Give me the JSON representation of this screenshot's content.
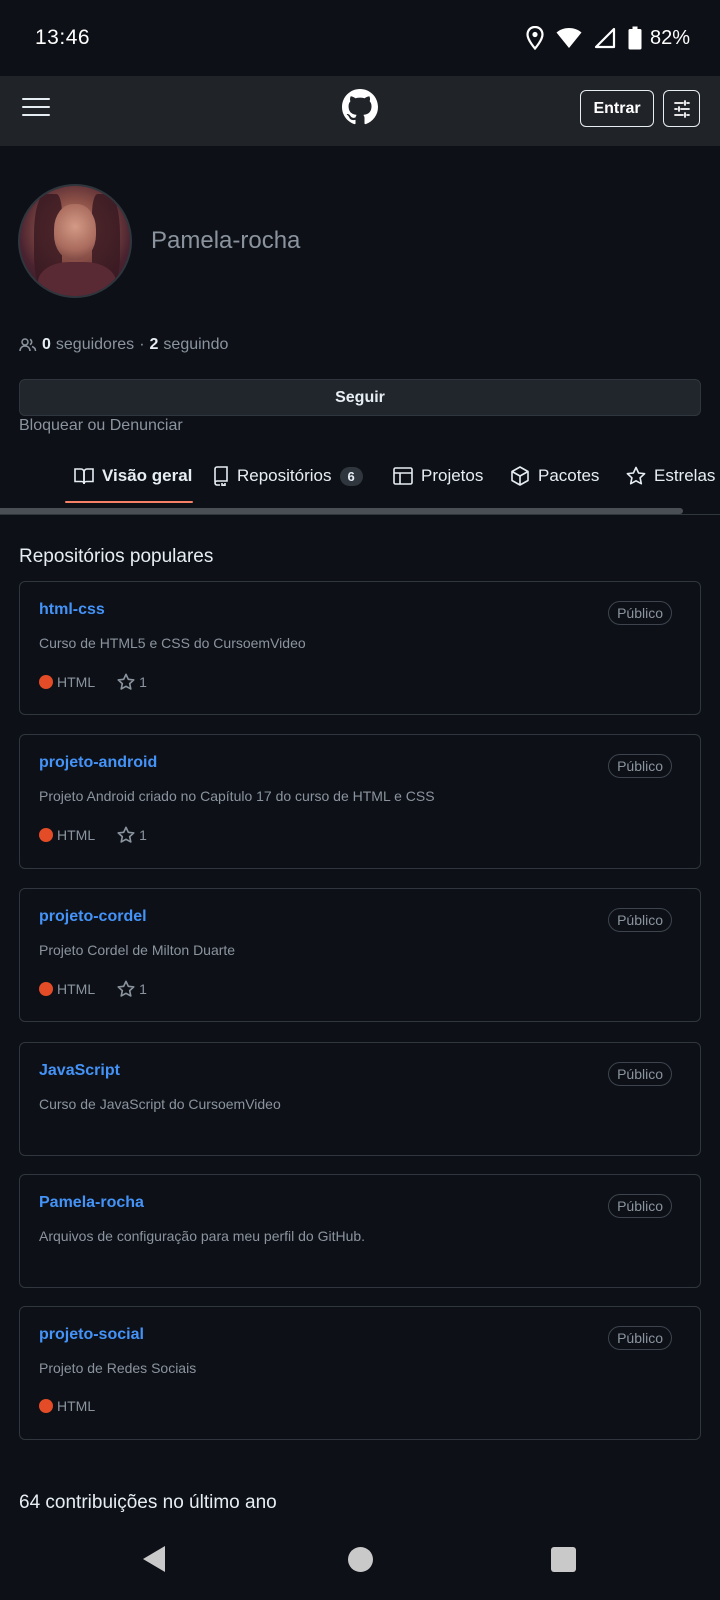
{
  "status_bar": {
    "time": "13:46",
    "battery": "82%"
  },
  "header": {
    "login_label": "Entrar"
  },
  "profile": {
    "username": "Pamela-rocha",
    "followers_count": "0",
    "followers_label": "seguidores",
    "separator": "·",
    "following_count": "2",
    "following_label": "seguindo",
    "follow_button": "Seguir",
    "block_link": "Bloquear ou Denunciar"
  },
  "tabs": [
    {
      "label": "Visão geral",
      "icon": "book-icon"
    },
    {
      "label": "Repositórios",
      "icon": "repo-icon",
      "count": "6"
    },
    {
      "label": "Projetos",
      "icon": "table-icon"
    },
    {
      "label": "Pacotes",
      "icon": "package-icon"
    },
    {
      "label": "Estrelas",
      "icon": "star-icon"
    }
  ],
  "popular": {
    "title": "Repositórios populares",
    "repos": [
      {
        "name": "html-css",
        "visibility": "Público",
        "description": "Curso de HTML5 e CSS do CursoemVideo",
        "language": "HTML",
        "stars": "1"
      },
      {
        "name": "projeto-android",
        "visibility": "Público",
        "description": "Projeto Android criado no Capítulo 17 do curso de HTML e CSS",
        "language": "HTML",
        "stars": "1"
      },
      {
        "name": "projeto-cordel",
        "visibility": "Público",
        "description": "Projeto Cordel de Milton Duarte",
        "language": "HTML",
        "stars": "1"
      },
      {
        "name": "JavaScript",
        "visibility": "Público",
        "description": "Curso de JavaScript do CursoemVideo"
      },
      {
        "name": "Pamela-rocha",
        "visibility": "Público",
        "description": "Arquivos de configuração para meu perfil do GitHub."
      },
      {
        "name": "projeto-social",
        "visibility": "Público",
        "description": "Projeto de Redes Sociais",
        "language": "HTML"
      }
    ]
  },
  "contributions": "64 contribuições no último ano",
  "colors": {
    "html_lang": "#e34c26",
    "link": "#4493f8",
    "tab_underline": "#f78166"
  }
}
